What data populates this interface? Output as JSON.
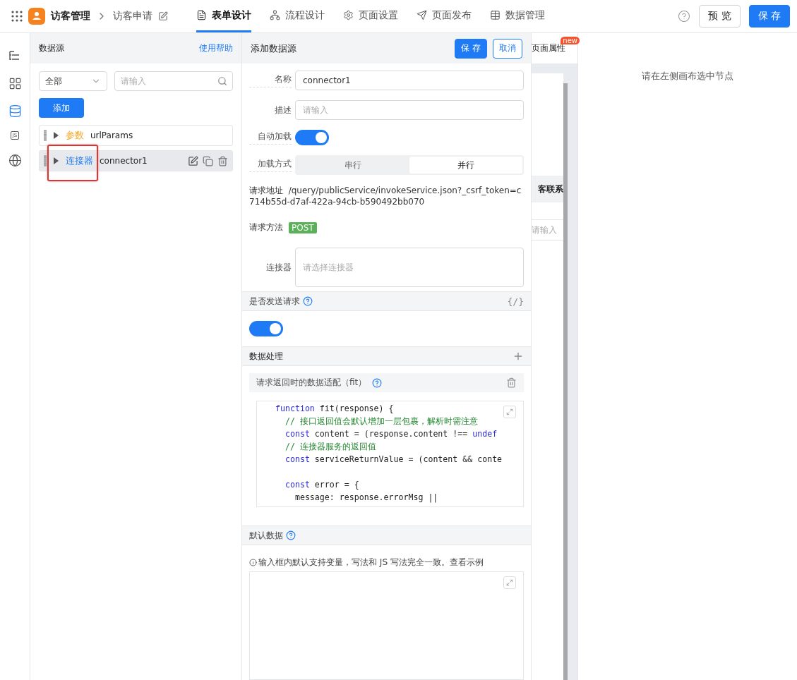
{
  "header": {
    "app_name": "访客管理",
    "page_name": "访客申请",
    "tabs": [
      {
        "label": "表单设计",
        "selected": true
      },
      {
        "label": "流程设计",
        "selected": false
      },
      {
        "label": "页面设置",
        "selected": false
      },
      {
        "label": "页面发布",
        "selected": false
      },
      {
        "label": "数据管理",
        "selected": false
      }
    ],
    "preview_button": "预 览",
    "save_button": "保 存"
  },
  "rail": [
    {
      "selected": false
    },
    {
      "selected": false
    },
    {
      "selected": true
    },
    {
      "selected": false,
      "label": "JS"
    },
    {
      "selected": false
    }
  ],
  "datasource_panel": {
    "title": "数据源",
    "help_link": "使用帮助",
    "filter": {
      "value": "全部"
    },
    "search": {
      "placeholder": "请输入"
    },
    "add_button": "添加",
    "items": [
      {
        "tag": "参数",
        "color": "#f5a623",
        "name": "urlParams",
        "selected": false,
        "annotated": false,
        "actions": false
      },
      {
        "tag": "连接器",
        "color": "#1e7bf5",
        "name": "connector1",
        "selected": true,
        "annotated": true,
        "actions": true
      }
    ]
  },
  "form": {
    "title": "添加数据源",
    "save_button": "保 存",
    "cancel_button": "取消",
    "name": {
      "label": "名称",
      "value": "connector1"
    },
    "description": {
      "label": "描述",
      "placeholder": "请输入"
    },
    "auto_load": {
      "label": "自动加载",
      "on": true
    },
    "load_mode": {
      "label": "加载方式",
      "options": [
        {
          "label": "串行",
          "selected": false
        },
        {
          "label": "并行",
          "selected": true
        }
      ]
    },
    "request_url": {
      "label": "请求地址",
      "value": "/query/publicService/invokeService.json?_csrf_token=c714b55d-d7af-422a-94cb-b590492bb070"
    },
    "request_method": {
      "label": "请求方法",
      "value": "POST"
    },
    "connector": {
      "label": "连接器",
      "placeholder": "请选择连接器"
    },
    "send_request": {
      "label": "是否发送请求",
      "code_toggle": "{/}",
      "on": true
    },
    "data_processing": {
      "label": "数据处理",
      "fit": {
        "label": "请求返回时的数据适配（fit）",
        "code": [
          {
            "kind": "code",
            "tokens": [
              {
                "kind": "kw",
                "s": "function"
              },
              {
                "kind": "plain",
                "s": " fit(response) {"
              }
            ]
          },
          {
            "kind": "code",
            "tokens": [
              {
                "kind": "comment",
                "s": "  // 接口返回值会默认增加一层包裹，解析时需注意"
              }
            ]
          },
          {
            "kind": "code",
            "tokens": [
              {
                "kind": "kw",
                "s": "  const"
              },
              {
                "kind": "plain",
                "s": " content = (response.content !== "
              },
              {
                "kind": "kw",
                "s": "undef"
              }
            ]
          },
          {
            "kind": "code",
            "tokens": [
              {
                "kind": "comment",
                "s": "  // 连接器服务的返回值"
              }
            ]
          },
          {
            "kind": "code",
            "tokens": [
              {
                "kind": "kw",
                "s": "  const"
              },
              {
                "kind": "plain",
                "s": " serviceReturnValue = (content && conte"
              }
            ]
          },
          {
            "kind": "blank"
          },
          {
            "kind": "code",
            "tokens": [
              {
                "kind": "kw",
                "s": "  const"
              },
              {
                "kind": "plain",
                "s": " error = {"
              }
            ]
          },
          {
            "kind": "code",
            "tokens": [
              {
                "kind": "plain",
                "s": "    message: response.errorMsg ||"
              }
            ]
          }
        ]
      }
    },
    "default_data": {
      "label": "默认数据",
      "hint": "输入框内默认支持变量，写法和 JS 写法完全一致。查看示例"
    }
  },
  "canvas": {
    "tab": "页面属性",
    "badge": "new",
    "column_header": "客联系",
    "input_placeholder": "请输入"
  },
  "properties_panel": {
    "empty_message": "请在左侧画布选中节点"
  }
}
